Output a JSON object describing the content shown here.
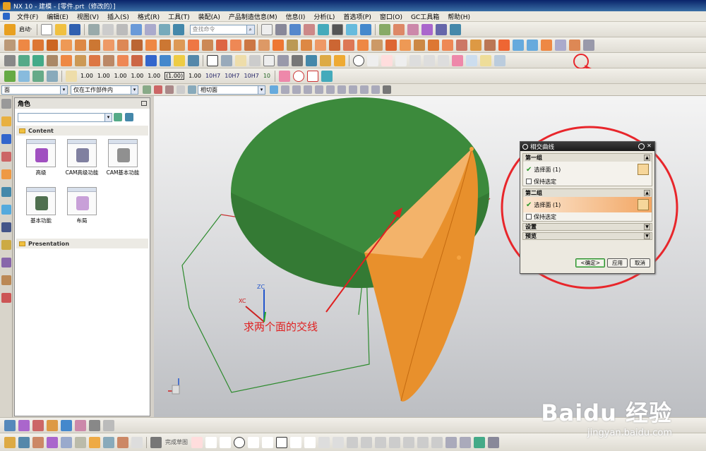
{
  "window": {
    "title": "NX 10 - 建模 - [零件.prt（修改的）]"
  },
  "menubar": {
    "items": [
      "文件(F)",
      "编辑(E)",
      "视图(V)",
      "插入(S)",
      "格式(R)",
      "工具(T)",
      "装配(A)",
      "产品制造信息(M)",
      "信息(I)",
      "分析(L)",
      "首选项(P)",
      "窗口(O)",
      "GC工具箱",
      "帮助(H)"
    ]
  },
  "toolbar": {
    "start_label": "启动·",
    "search_placeholder": "查找命令",
    "tolerance_labels": [
      "1.00",
      "1.00",
      "1.00",
      "1.00",
      "1.00",
      "(1.00)",
      "1.00",
      "10H7",
      "10H7",
      "10H7",
      "10"
    ]
  },
  "selection_bar": {
    "filter_type": "面",
    "scope": "仅在工作部件内",
    "render_mode": "相切面"
  },
  "roles_panel": {
    "title": "角色",
    "content_section": "Content",
    "presentation_section": "Presentation",
    "roles": [
      {
        "label": "高级",
        "icon": "tools-icon"
      },
      {
        "label": "CAM高级功能",
        "icon": "cam-advanced-icon"
      },
      {
        "label": "CAM基本功能",
        "icon": "cam-basic-icon"
      },
      {
        "label": "基本功能",
        "icon": "tools-basic-icon"
      },
      {
        "label": "布局",
        "icon": "layout-icon"
      }
    ]
  },
  "canvas": {
    "axis_labels": {
      "zc": "ZC",
      "xc": "XC"
    },
    "annotation": "求两个面的交线"
  },
  "dialog": {
    "title": "相交曲线",
    "group1": {
      "title": "第一组",
      "select_face": "选择面 (1)",
      "keep_selected": "保持选定"
    },
    "group2": {
      "title": "第二组",
      "select_face": "选择面 (1)",
      "keep_selected": "保持选定"
    },
    "settings": "设置",
    "preview": "预览",
    "buttons": {
      "ok": "<确定>",
      "apply": "应用",
      "cancel": "取消"
    }
  },
  "bottom_toolbar": {
    "sketch_label": "完成草图"
  },
  "watermark": {
    "brand": "Baidu 经验",
    "url": "jingyan.baidu.com"
  },
  "colors": {
    "annotation": "#e02020",
    "cone_green": "#3c8a3c",
    "surface_orange": "#e8902c"
  }
}
